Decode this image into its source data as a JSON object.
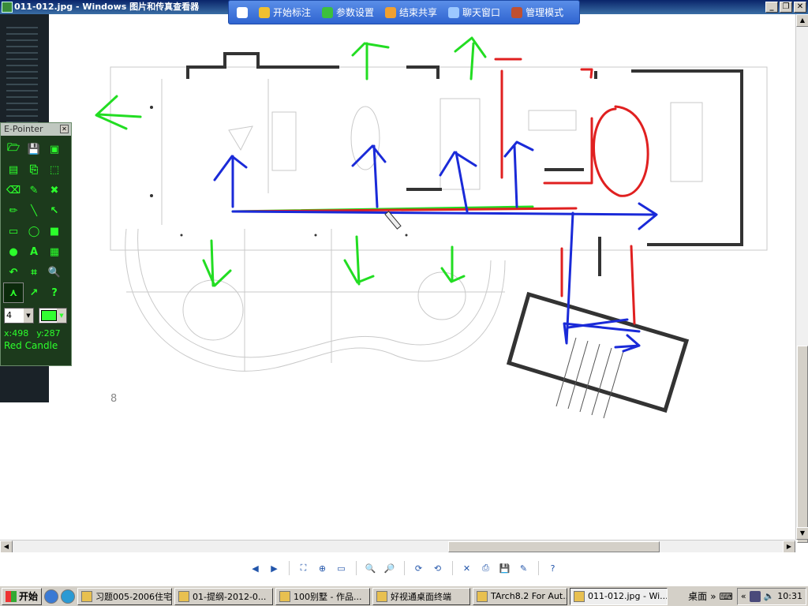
{
  "window": {
    "title": "011-012.jpg - Windows 图片和传真查看器",
    "controls": [
      "_",
      "❐",
      "✕"
    ]
  },
  "floatbar": {
    "items": [
      {
        "icon": "pin-icon",
        "label": "",
        "color": "#ffffff"
      },
      {
        "icon": "pen-icon",
        "label": "开始标注",
        "color": "#f0c030"
      },
      {
        "icon": "settings-icon",
        "label": "参数设置",
        "color": "#3cc03c"
      },
      {
        "icon": "share-end-icon",
        "label": "结束共享",
        "color": "#f0a030"
      },
      {
        "icon": "chat-icon",
        "label": "聊天窗口",
        "color": "#9cc8ff"
      },
      {
        "icon": "admin-icon",
        "label": "管理模式",
        "color": "#c05030"
      }
    ]
  },
  "page_number": "8",
  "epointer": {
    "title": "E-Pointer",
    "tools": [
      {
        "glyph": "🗁",
        "name": "open-icon"
      },
      {
        "glyph": "💾",
        "name": "save-icon"
      },
      {
        "glyph": "▣",
        "name": "capture-icon"
      },
      {
        "glyph": "▤",
        "name": "board-icon"
      },
      {
        "glyph": "⎘",
        "name": "copy-icon"
      },
      {
        "glyph": "⬚",
        "name": "select-rect-icon"
      },
      {
        "glyph": "⌫",
        "name": "eraser-icon"
      },
      {
        "glyph": "✎",
        "name": "dropper-icon"
      },
      {
        "glyph": "✖",
        "name": "clear-icon"
      },
      {
        "glyph": "✏",
        "name": "pencil-icon"
      },
      {
        "glyph": "╲",
        "name": "line-icon"
      },
      {
        "glyph": "↖",
        "name": "arrow-icon"
      },
      {
        "glyph": "▭",
        "name": "rectangle-icon"
      },
      {
        "glyph": "◯",
        "name": "ellipse-icon"
      },
      {
        "glyph": "■",
        "name": "filled-rect-icon"
      },
      {
        "glyph": "●",
        "name": "filled-ellipse-icon"
      },
      {
        "glyph": "A",
        "name": "text-icon"
      },
      {
        "glyph": "▦",
        "name": "highlighter-icon"
      },
      {
        "glyph": "↶",
        "name": "undo-icon"
      },
      {
        "glyph": "⌗",
        "name": "calculator-icon"
      },
      {
        "glyph": "🔍",
        "name": "zoom-icon"
      },
      {
        "glyph": "⋏",
        "name": "spotlight-icon"
      },
      {
        "glyph": "↗",
        "name": "pointer-icon"
      },
      {
        "glyph": "?",
        "name": "help-icon"
      }
    ],
    "selected_tool_index": 21,
    "pen_width": "4",
    "pen_color": "#33ff33",
    "coord_x": "x:498",
    "coord_y": "y:287",
    "pen_name": "Red Candle"
  },
  "viewer_toolbar": [
    {
      "glyph": "◀",
      "name": "prev-image-icon"
    },
    {
      "glyph": "▶",
      "name": "next-image-icon"
    },
    {
      "sep": true
    },
    {
      "glyph": "⛶",
      "name": "best-fit-icon"
    },
    {
      "glyph": "⊕",
      "name": "actual-size-icon"
    },
    {
      "glyph": "▭",
      "name": "slideshow-icon"
    },
    {
      "sep": true
    },
    {
      "glyph": "🔍",
      "name": "zoom-in-icon"
    },
    {
      "glyph": "🔎",
      "name": "zoom-out-icon"
    },
    {
      "sep": true
    },
    {
      "glyph": "⟳",
      "name": "rotate-clockwise-icon"
    },
    {
      "glyph": "⟲",
      "name": "rotate-counterclockwise-icon"
    },
    {
      "sep": true
    },
    {
      "glyph": "✕",
      "name": "delete-icon"
    },
    {
      "glyph": "⎙",
      "name": "print-icon"
    },
    {
      "glyph": "💾",
      "name": "copy-to-icon"
    },
    {
      "glyph": "✎",
      "name": "edit-icon"
    },
    {
      "sep": true
    },
    {
      "glyph": "?",
      "name": "help-icon"
    }
  ],
  "taskbar": {
    "start": "开始",
    "tasks": [
      {
        "label": "习题005-2006住宅",
        "width": 120
      },
      {
        "label": "01-提纲-2012-0...",
        "width": 125
      },
      {
        "label": "100别墅 - 作品...",
        "width": 120
      },
      {
        "label": "好视通桌面终端",
        "width": 124
      },
      {
        "label": "TArch8.2 For Aut...",
        "width": 120
      },
      {
        "label": "011-012.jpg - Wi...",
        "width": 124,
        "active": true
      }
    ],
    "desktop": "桌面",
    "clock": "10:31"
  }
}
